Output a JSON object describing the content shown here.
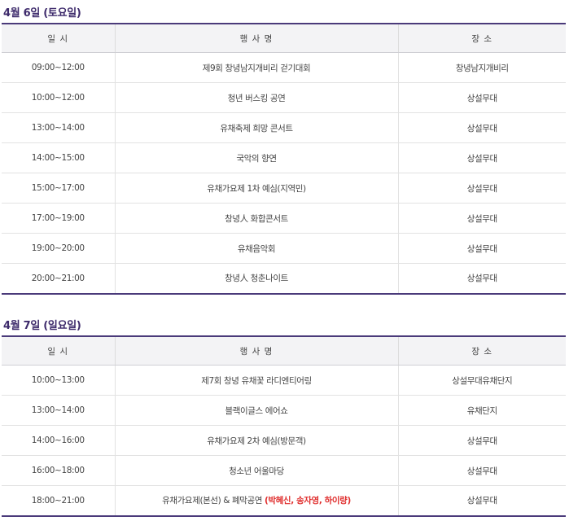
{
  "day1": {
    "title": "4월 6일 (토요일)",
    "headers": {
      "time": "일 시",
      "event": "행 사 명",
      "place": "장 소"
    },
    "rows": [
      {
        "time": "09:00~12:00",
        "event": "제9회 창녕남지개비리 걷기대회",
        "place": "창녕남지개비리"
      },
      {
        "time": "10:00~12:00",
        "event": "청년 버스킹 공연",
        "place": "상설무대"
      },
      {
        "time": "13:00~14:00",
        "event": "유채축제 희망 콘서트",
        "place": "상설무대"
      },
      {
        "time": "14:00~15:00",
        "event": "국악의 향연",
        "place": "상설무대"
      },
      {
        "time": "15:00~17:00",
        "event": "유채가요제 1차 예심(지역민)",
        "place": "상설무대"
      },
      {
        "time": "17:00~19:00",
        "event": "창녕人 화합콘서트",
        "place": "상설무대"
      },
      {
        "time": "19:00~20:00",
        "event": "유채음악회",
        "place": "상설무대"
      },
      {
        "time": "20:00~21:00",
        "event": "창녕人 청춘나이트",
        "place": "상설무대"
      }
    ]
  },
  "day2": {
    "title": "4월 7일 (일요일)",
    "headers": {
      "time": "일 시",
      "event": "행 사 명",
      "place": "장 소"
    },
    "rows": [
      {
        "time": "10:00~13:00",
        "event": "제7회 창녕 유채꽃 라디엔티어링",
        "place": "상설무대유채단지"
      },
      {
        "time": "13:00~14:00",
        "event": "블랙이글스 에어쇼",
        "place": "유채단지"
      },
      {
        "time": "14:00~16:00",
        "event": "유채가요제 2차 예심(방문객)",
        "place": "상설무대"
      },
      {
        "time": "16:00~18:00",
        "event": "청소년 어울마당",
        "place": "상설무대"
      },
      {
        "time": "18:00~21:00",
        "event": "유채가요제(본선) & 폐막공연 ",
        "event_highlight": "(박혜신, 송자영, 하이량)",
        "place": "상설무대"
      }
    ]
  },
  "colors": {
    "title": "#3d2a6b",
    "border_accent": "#4a3a7a",
    "highlight": "#e0302f",
    "header_bg": "#f3f3f5"
  }
}
